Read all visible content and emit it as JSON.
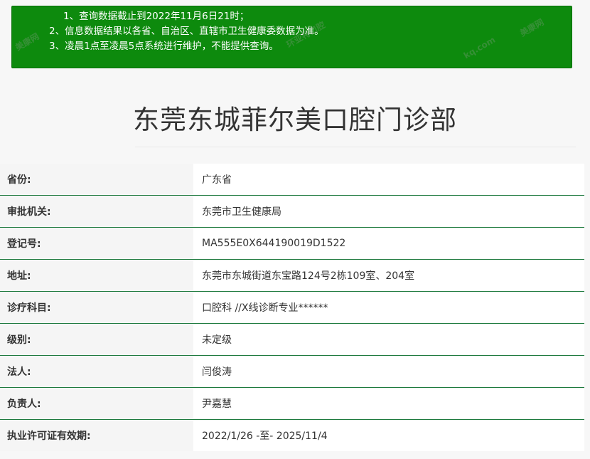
{
  "notice": {
    "lines": [
      "1、查询数据截止到2022年11月6日21时；",
      "2、信息数据结果以各省、自治区、直辖市卫生健康委数据为准。",
      "3、凌晨1点至凌晨5点系统进行维护，不能提供查询。"
    ]
  },
  "page_title": "东莞东城菲尔美口腔门诊部",
  "rows": [
    {
      "label": "省份:",
      "value": "广东省"
    },
    {
      "label": "审批机关:",
      "value": "东莞市卫生健康局"
    },
    {
      "label": "登记号:",
      "value": "MA555E0X644190019D1522"
    },
    {
      "label": "地址:",
      "value": "东莞市东城街道东宝路124号2栋109室、204室"
    },
    {
      "label": "诊疗科目:",
      "value": "口腔科 //X线诊断专业******"
    },
    {
      "label": "级别:",
      "value": "未定级"
    },
    {
      "label": "法人:",
      "value": "闫俊涛"
    },
    {
      "label": "负责人:",
      "value": "尹嘉慧"
    },
    {
      "label": "执业许可证有效期:",
      "value": "2022/1/26 -至- 2025/11/4"
    }
  ],
  "watermarks": [
    "美康网",
    "环亚特口腔",
    "kq.com",
    "美康网"
  ],
  "colors": {
    "notice_bg": "#0d8a0d",
    "row_border": "#1e7a3e"
  }
}
